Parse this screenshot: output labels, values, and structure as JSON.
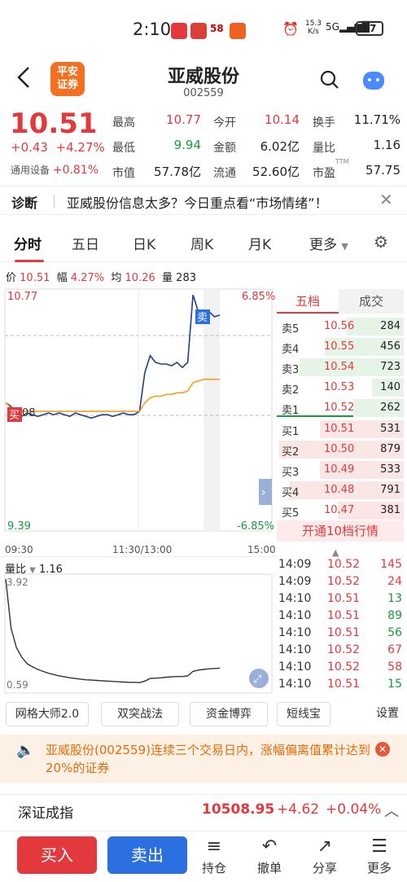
{
  "status_bar": {
    "time": "2:10",
    "net_speed": "15.3 K/s",
    "signal": "5G",
    "battery": "97"
  },
  "header": {
    "title": "亚威股份",
    "code": "002559",
    "logo_text": "平安\n证券"
  },
  "quote": {
    "price": "10.51",
    "change": "+0.43",
    "change_pct": "+4.27%",
    "sector_name": "通用设备",
    "sector_pct": "+0.81%",
    "fields": [
      {
        "label": "最高",
        "value": "10.77",
        "color": "red"
      },
      {
        "label": "今开",
        "value": "10.14",
        "color": "red"
      },
      {
        "label": "换手",
        "value": "11.71%",
        "color": "dark"
      },
      {
        "label": "最低",
        "value": "9.94",
        "color": "green"
      },
      {
        "label": "金额",
        "value": "6.02亿",
        "color": "dark"
      },
      {
        "label": "量比",
        "value": "1.16",
        "color": "dark"
      },
      {
        "label": "市值",
        "value": "57.78亿",
        "color": "dark"
      },
      {
        "label": "流通",
        "value": "52.60亿",
        "color": "dark"
      },
      {
        "label": "市盈",
        "value": "57.75",
        "color": "dark",
        "sup": "TTM"
      }
    ]
  },
  "diagnosis": {
    "tag": "诊断",
    "text": "亚威股份信息太多？今日重点看“市场情绪”！"
  },
  "tabs": [
    "分时",
    "五日",
    "日K",
    "周K",
    "月K",
    "更多"
  ],
  "chart_info": {
    "price_label": "价",
    "price": "10.51",
    "amp_label": "幅",
    "amp": "4.27%",
    "avg_label": "均",
    "avg": "10.26",
    "vol_label": "量",
    "vol": "283"
  },
  "chart_axis": {
    "top_price": "10.77",
    "bottom_price": "9.39",
    "top_pct": "6.85%",
    "bottom_pct": "-6.85%",
    "mid_price": "08",
    "t_start": "09:30",
    "t_mid": "11:30/13:00",
    "t_end": "15:00",
    "buy_mark": "买",
    "sell_mark": "卖"
  },
  "chart_data": {
    "type": "line",
    "series": [
      {
        "values": [
          10.12,
          10.1,
          10.05,
          10.04,
          10.06,
          10.05,
          10.04,
          10.05,
          10.06,
          10.05,
          10.06,
          10.05,
          10.04,
          10.06,
          10.05,
          10.04,
          10.03,
          10.04,
          10.05,
          10.05,
          10.04,
          10.05,
          10.06,
          10.05,
          10.05,
          10.07,
          10.3,
          10.4,
          10.36,
          10.35,
          10.35,
          10.34,
          10.36,
          10.33,
          10.36,
          10.76,
          10.66,
          10.64,
          10.66,
          10.63,
          10.64
        ]
      },
      {
        "values": [
          10.12,
          10.09,
          10.07,
          10.07,
          10.07,
          10.07,
          10.07,
          10.07,
          10.07,
          10.07,
          10.07,
          10.07,
          10.07,
          10.07,
          10.07,
          10.07,
          10.07,
          10.07,
          10.07,
          10.07,
          10.07,
          10.07,
          10.07,
          10.07,
          10.07,
          10.07,
          10.12,
          10.15,
          10.16,
          10.16,
          10.17,
          10.17,
          10.18,
          10.18,
          10.19,
          10.24,
          10.25,
          10.26,
          10.26,
          10.26,
          10.26
        ]
      }
    ],
    "ylim": [
      9.39,
      10.77
    ],
    "prev_close": 10.08
  },
  "volume_ratio": {
    "label": "量比",
    "value": "1.16",
    "top": "3.92",
    "bottom": "0.59"
  },
  "volume_ratio_data": [
    3.92,
    2.4,
    1.8,
    1.5,
    1.3,
    1.2,
    1.12,
    1.06,
    1.0,
    0.96,
    0.92,
    0.89,
    0.86,
    0.84,
    0.82,
    0.8,
    0.79,
    0.78,
    0.77,
    0.76,
    0.75,
    0.74,
    0.73,
    0.72,
    0.72,
    0.71,
    0.76,
    0.84,
    0.85,
    0.86,
    0.88,
    0.89,
    0.9,
    0.9,
    0.92,
    1.06,
    1.1,
    1.12,
    1.14,
    1.15,
    1.16
  ],
  "order_book": {
    "tab_five": "五档",
    "tab_trades": "成交",
    "sells": [
      {
        "label": "卖5",
        "price": "10.56",
        "vol": "284",
        "fill": 0.45
      },
      {
        "label": "卖4",
        "price": "10.55",
        "vol": "456",
        "fill": 0.62
      },
      {
        "label": "卖3",
        "price": "10.54",
        "vol": "723",
        "fill": 0.82
      },
      {
        "label": "卖2",
        "price": "10.53",
        "vol": "140",
        "fill": 0.25
      },
      {
        "label": "卖1",
        "price": "10.52",
        "vol": "262",
        "fill": 0.4
      }
    ],
    "buys": [
      {
        "label": "买1",
        "price": "10.51",
        "vol": "531",
        "fill": 0.66
      },
      {
        "label": "买2",
        "price": "10.50",
        "vol": "879",
        "fill": 0.98
      },
      {
        "label": "买3",
        "price": "10.49",
        "vol": "533",
        "fill": 0.66
      },
      {
        "label": "买4",
        "price": "10.48",
        "vol": "791",
        "fill": 0.9
      },
      {
        "label": "买5",
        "price": "10.47",
        "vol": "381",
        "fill": 0.52
      }
    ],
    "more_button": "开通10档行情"
  },
  "trades": [
    {
      "time": "14:09",
      "price": "10.52",
      "vol": "145",
      "dir": "red"
    },
    {
      "time": "14:09",
      "price": "10.52",
      "vol": "24",
      "dir": "red"
    },
    {
      "time": "14:10",
      "price": "10.51",
      "vol": "13",
      "dir": "green"
    },
    {
      "time": "14:10",
      "price": "10.51",
      "vol": "89",
      "dir": "green"
    },
    {
      "time": "14:10",
      "price": "10.51",
      "vol": "56",
      "dir": "green"
    },
    {
      "time": "14:10",
      "price": "10.52",
      "vol": "67",
      "dir": "red"
    },
    {
      "time": "14:10",
      "price": "10.52",
      "vol": "58",
      "dir": "red"
    },
    {
      "time": "14:10",
      "price": "10.51",
      "vol": "15",
      "dir": "green"
    }
  ],
  "tools": [
    "网格大师2.0",
    "双突战法",
    "资金博弈",
    "短线宝",
    "设置"
  ],
  "notice": {
    "text": "亚威股份(002559)连续三个交易日内，涨幅偏离值累计达到20%的证券"
  },
  "index": {
    "name": "深证成指",
    "value": "10508.95",
    "change": "+4.62",
    "pct": "+0.04%"
  },
  "bottom": {
    "buy": "买入",
    "sell": "卖出",
    "icons": [
      {
        "label": "持仓",
        "icon": "≡"
      },
      {
        "label": "撤单",
        "icon": "↶"
      },
      {
        "label": "分享",
        "icon": "↗"
      },
      {
        "label": "更多",
        "icon": "☰"
      }
    ]
  },
  "colors": {
    "up": "#e4393c",
    "down": "#1a9a3a",
    "line": "#1e3f8a",
    "avg": "#f0a020",
    "accent": "#e4393c",
    "sell_button": "#2c6fe0"
  }
}
